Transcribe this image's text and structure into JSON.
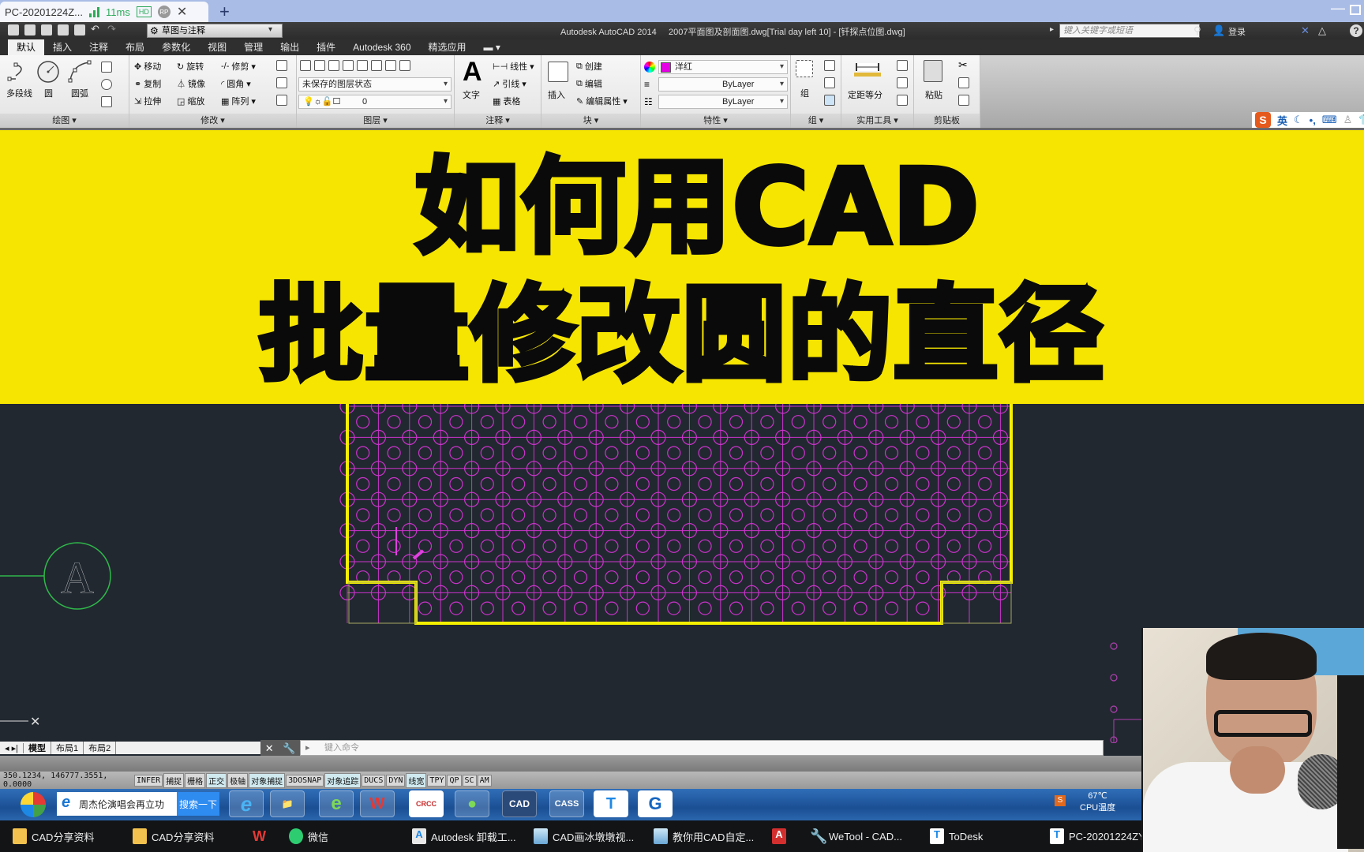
{
  "remote_tab": {
    "title": "PC-20201224Z...",
    "latency": "11ms",
    "hd_badge": "HD",
    "rp_badge": "RP",
    "close": "✕",
    "add": "+"
  },
  "window_controls": {
    "minimize": "—"
  },
  "quick_access": {
    "workspace": "草图与注释",
    "icons": [
      "new-icon",
      "open-icon",
      "save-icon",
      "save-as-icon",
      "print-icon",
      "undo-icon",
      "redo-icon"
    ]
  },
  "app_title": "Autodesk AutoCAD 2014     2007平面图及剖面图.dwg[Trial day left 10] - [钎探点位图.dwg]",
  "infocenter": {
    "search_placeholder": "键入关键字或短语",
    "login": "登录"
  },
  "ribbon_tabs": [
    {
      "label": "默认",
      "active": true
    },
    {
      "label": "插入"
    },
    {
      "label": "注释"
    },
    {
      "label": "布局"
    },
    {
      "label": "参数化"
    },
    {
      "label": "视图"
    },
    {
      "label": "管理"
    },
    {
      "label": "输出"
    },
    {
      "label": "插件"
    },
    {
      "label": "Autodesk 360"
    },
    {
      "label": "精选应用"
    }
  ],
  "ribbon": {
    "draw": {
      "title": "绘图",
      "polyline": "多段线",
      "circle": "圆",
      "arc": "圆弧"
    },
    "modify": {
      "title": "修改",
      "items": [
        "移动",
        "旋转",
        "修剪",
        "复制",
        "镜像",
        "圆角",
        "拉伸",
        "缩放",
        "阵列"
      ]
    },
    "layers": {
      "title": "图层",
      "layer_state": "未保存的图层状态",
      "current_layer": "0"
    },
    "annotation": {
      "title": "注释",
      "text": "文字",
      "items": [
        "线性",
        "引线",
        "表格"
      ]
    },
    "block": {
      "title": "块",
      "insert": "插入",
      "items": [
        "创建",
        "编辑",
        "编辑属性"
      ]
    },
    "properties": {
      "title": "特性",
      "color": "洋红",
      "color_hex": "#e600e6",
      "lineweight": "ByLayer",
      "linetype": "ByLayer"
    },
    "groups": {
      "title": "组",
      "group": "组"
    },
    "utilities": {
      "title": "实用工具",
      "measure": "定距等分"
    },
    "clipboard": {
      "title": "剪贴板",
      "paste": "粘贴"
    }
  },
  "ime": {
    "logo": "S",
    "mode": "英",
    "icons": [
      "moon-icon",
      "punctuation-icon",
      "keyboard-icon",
      "user-icon",
      "skin-icon"
    ]
  },
  "banner": {
    "line1": "如何用CAD",
    "line2": "批量修改圆的直径",
    "bg_color": "#f6e500"
  },
  "drawing": {
    "grid_axis_label": "A",
    "outline_color": "#f5f000",
    "circle_color": "#cc33cc",
    "axis_circle_color": "#2fb84a"
  },
  "layout_tabs": [
    {
      "label": "模型",
      "active": true
    },
    {
      "label": "布局1"
    },
    {
      "label": "布局2"
    }
  ],
  "command_line": {
    "placeholder": "键入命令"
  },
  "status_bar": {
    "coordinates": "350.1234, 146777.3551, 0.0000",
    "toggles": [
      {
        "label": "INFER",
        "on": false
      },
      {
        "label": "捕捉",
        "on": false
      },
      {
        "label": "栅格",
        "on": false
      },
      {
        "label": "正交",
        "on": true
      },
      {
        "label": "极轴",
        "on": false
      },
      {
        "label": "对象捕捉",
        "on": true
      },
      {
        "label": "3DOSNAP",
        "on": false
      },
      {
        "label": "对象追踪",
        "on": true
      },
      {
        "label": "DUCS",
        "on": false
      },
      {
        "label": "DYN",
        "on": false
      },
      {
        "label": "线宽",
        "on": true
      },
      {
        "label": "TPY",
        "on": false
      },
      {
        "label": "QP",
        "on": false
      },
      {
        "label": "SC",
        "on": false
      },
      {
        "label": "AM",
        "on": false
      }
    ]
  },
  "remote_taskbar": {
    "search_text": "周杰伦演唱会再立功",
    "search_button": "搜索一下",
    "apps": [
      "ie-icon",
      "explorer-icon",
      "browser-icon",
      "wps-icon",
      "crcc-icon",
      "wechat-icon",
      "cad-icon",
      "cass-icon",
      "todesk-icon",
      "gstarcad-icon"
    ],
    "cpu_temp": "67℃",
    "cpu_label": "CPU温度"
  },
  "taskbar": [
    {
      "label": "CAD分享资料",
      "icon": "folder-icon"
    },
    {
      "label": "CAD分享资料",
      "icon": "folder-icon"
    },
    {
      "label": "",
      "icon": "wps-icon"
    },
    {
      "label": "微信",
      "icon": "wechat-icon"
    },
    {
      "label": "Autodesk 卸载工...",
      "icon": "autodesk-icon"
    },
    {
      "label": "CAD画冰墩墩视...",
      "icon": "video-icon"
    },
    {
      "label": "教你用CAD自定...",
      "icon": "video-icon"
    },
    {
      "label": "",
      "icon": "autocad-icon"
    },
    {
      "label": "WeTool - CAD...",
      "icon": "wetool-icon"
    },
    {
      "label": "ToDesk",
      "icon": "todesk-icon"
    },
    {
      "label": "PC-20201224ZY",
      "icon": "todesk-icon"
    }
  ]
}
